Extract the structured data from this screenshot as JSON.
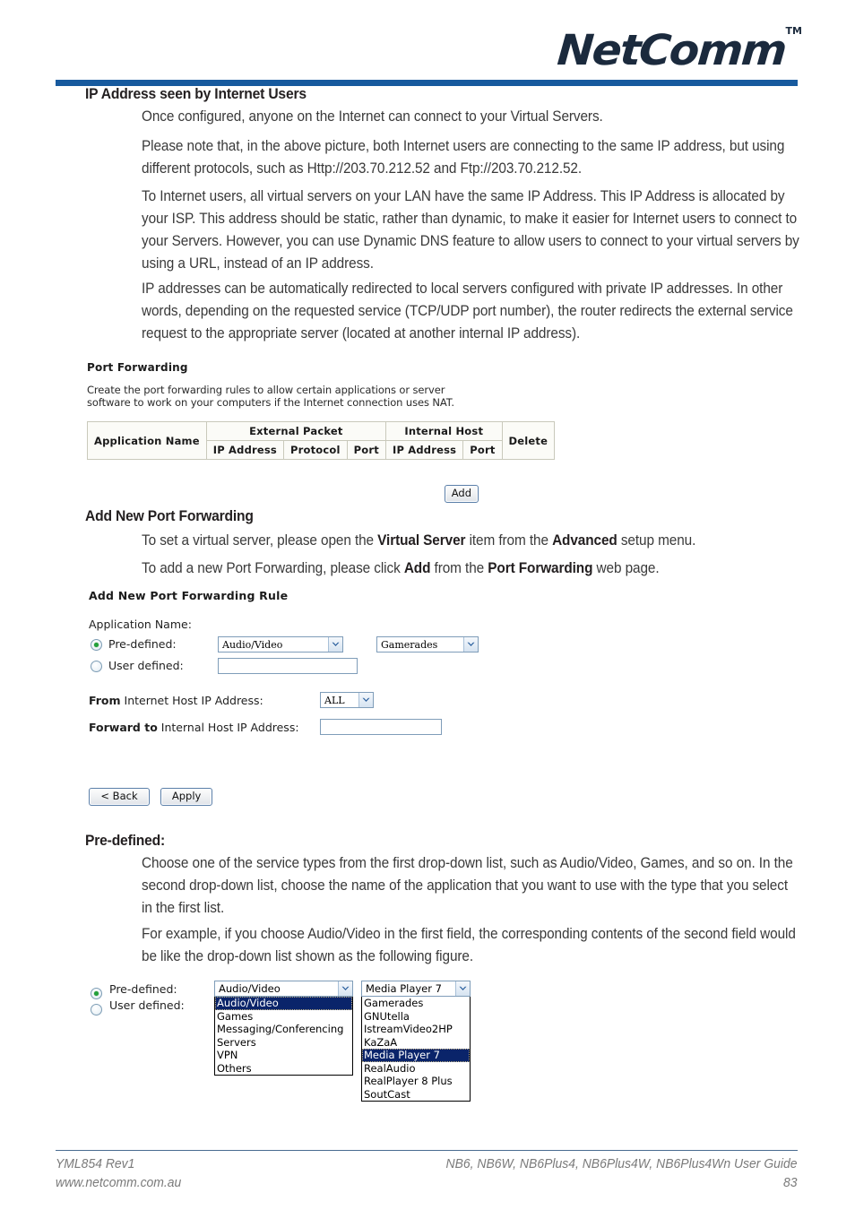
{
  "brand": {
    "logo_text": "NetComm",
    "logo_tm": "TM",
    "rule_color": "#175a9e"
  },
  "sections": {
    "heading_1": "IP Address seen by Internet Users",
    "para_1": "Once configured, anyone on the Internet can connect to your Virtual Servers.",
    "para_2": "Please note that, in the above picture, both Internet users are connecting to the same IP address, but using different protocols, such as Http://203.70.212.52 and Ftp://203.70.212.52.",
    "para_3": "To Internet users, all virtual servers on your LAN have the same IP Address. This IP Address is allocated by your ISP. This address should be static, rather than dynamic, to make it easier for Internet users to connect to your Servers. However, you can use Dynamic DNS feature to allow users to connect to your virtual servers by using a URL, instead of an IP address.",
    "para_4": "IP addresses can be automatically redirected to local servers configured with private IP addresses. In other words, depending on the requested service (TCP/UDP port number), the router redirects the external service request to the appropriate server (located at another internal IP address).",
    "heading_2": "Add New Port Forwarding",
    "para_5_a": "To set a virtual server, please open the ",
    "para_5_b": "Virtual Server",
    "para_5_c": " item from the ",
    "para_5_d": "Advanced",
    "para_5_e": " setup menu.",
    "para_6_a": "To add a new Port Forwarding, please click ",
    "para_6_b": "Add",
    "para_6_c": " from the ",
    "para_6_d": "Port Forwarding",
    "para_6_e": " web page.",
    "heading_3": "Pre-defined:",
    "para_7": "Choose one of the service types from the first drop-down list, such as Audio/Video, Games, and so on. In the second drop-down list, choose the name of the application that you want to use with the type that you select in the first list.",
    "para_8": "For example, if you choose Audio/Video in the first field, the corresponding contents of the second field would be like the drop-down list shown as the following figure."
  },
  "port_forwarding_screenshot": {
    "title": "Port Forwarding",
    "description_line1": "Create the port forwarding rules to allow certain applications or server",
    "description_line2": "software to work on your computers if the Internet connection uses NAT.",
    "table": {
      "col_application_name": "Application Name",
      "group_external_packet": "External Packet",
      "group_internal_host": "Internal Host",
      "col_delete": "Delete",
      "sub_headers": [
        "IP Address",
        "Protocol",
        "Port",
        "IP Address",
        "Port"
      ]
    },
    "add_button": "Add"
  },
  "add_rule_screenshot": {
    "title": "Add New Port Forwarding Rule",
    "application_name_label": "Application Name:",
    "predefined_label": "Pre-defined:",
    "predefined_selected": true,
    "user_defined_label": "User defined:",
    "user_defined_selected": false,
    "type_select_value": "Audio/Video",
    "app_select_value": "Gamerades",
    "user_defined_value": "",
    "from_label_bold": "From",
    "from_label_rest": " Internet Host IP Address:",
    "from_select_value": "ALL",
    "forward_label_bold": "Forward to",
    "forward_label_rest": " Internal Host IP Address:",
    "forward_value": "",
    "back_button": "< Back",
    "apply_button": "Apply"
  },
  "dropdown_figure": {
    "predefined_label": "Pre-defined:",
    "user_defined_label": "User defined:",
    "type_select_value": "Audio/Video",
    "type_options": [
      "Audio/Video",
      "Games",
      "Messaging/Conferencing",
      "Servers",
      "VPN",
      "Others"
    ],
    "type_selected_index": 0,
    "app_select_value": "Media Player 7",
    "app_options": [
      "Gamerades",
      "GNUtella",
      "IstreamVideo2HP",
      "KaZaA",
      "Media Player 7",
      "RealAudio",
      "RealPlayer 8 Plus",
      "SoutCast"
    ],
    "app_selected_index": 4
  },
  "footer": {
    "left_line1": "YML854 Rev1",
    "left_line2": "www.netcomm.com.au",
    "right_line1": "NB6, NB6W, NB6Plus4, NB6Plus4W, NB6Plus4Wn User Guide",
    "right_line2": "83"
  }
}
